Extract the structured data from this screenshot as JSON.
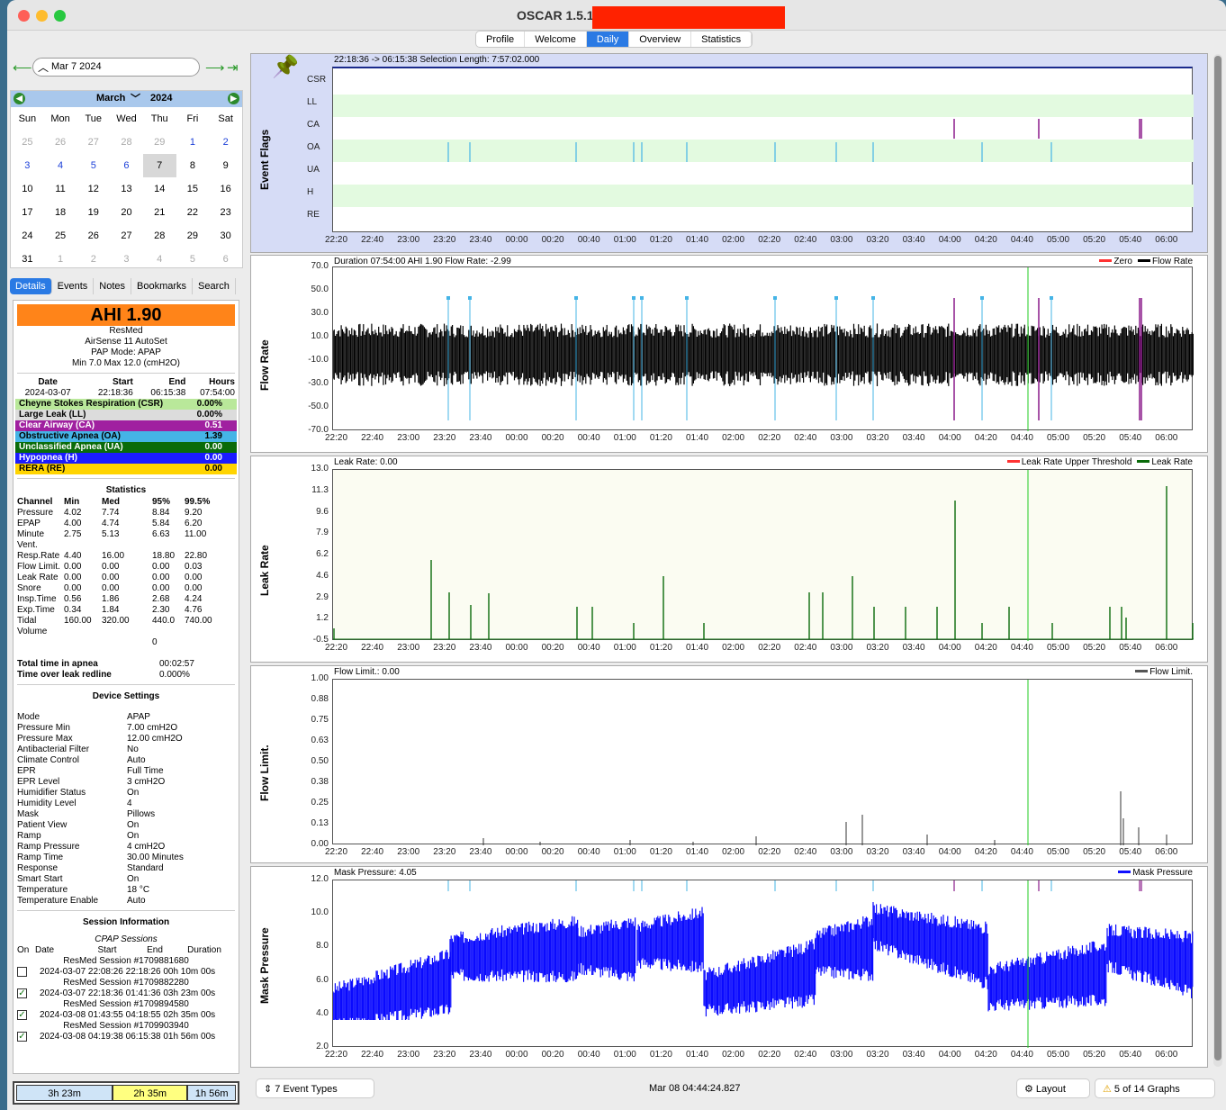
{
  "app": {
    "title": "OSCAR 1.5.1"
  },
  "tabs": [
    "Profile",
    "Welcome",
    "Daily",
    "Overview",
    "Statistics"
  ],
  "nav": {
    "date": "Mar 7 2024"
  },
  "calendar": {
    "month": "March",
    "year": "2024",
    "days": [
      "Sun",
      "Mon",
      "Tue",
      "Wed",
      "Thu",
      "Fri",
      "Sat"
    ],
    "cells": [
      "25",
      "26",
      "27",
      "28",
      "29",
      "1",
      "2",
      "3",
      "4",
      "5",
      "6",
      "7",
      "8",
      "9",
      "10",
      "11",
      "12",
      "13",
      "14",
      "15",
      "16",
      "17",
      "18",
      "19",
      "20",
      "21",
      "22",
      "23",
      "24",
      "25",
      "26",
      "27",
      "28",
      "29",
      "30",
      "31",
      "1",
      "2",
      "3",
      "4",
      "5",
      "6"
    ]
  },
  "left_tabs": [
    "Details",
    "Events",
    "Notes",
    "Bookmarks",
    "Search"
  ],
  "details": {
    "ahi": "AHI 1.90",
    "brand": "ResMed",
    "model": "AirSense 11 AutoSet",
    "mode": "PAP Mode: APAP",
    "range": "Min 7.0 Max 12.0 (cmH2O)",
    "hdr": [
      "Date",
      "Start",
      "End",
      "Hours"
    ],
    "vals": [
      "2024-03-07",
      "22:18:36",
      "06:15:38",
      "07:54:00"
    ],
    "events": [
      [
        "Cheyne Stokes Respiration (CSR)",
        "0.00%",
        "#b9e89a",
        "#000"
      ],
      [
        "Large Leak (LL)",
        "0.00%",
        "#dcdcdc",
        "#000"
      ],
      [
        "Clear Airway (CA)",
        "0.51",
        "#a020a0",
        "#fff"
      ],
      [
        "Obstructive Apnea (OA)",
        "1.39",
        "#45b4e6",
        "#000"
      ],
      [
        "Unclassified Apnea (UA)",
        "0.00",
        "#0a6b0a",
        "#fff"
      ],
      [
        "Hypopnea (H)",
        "0.00",
        "#1b1bff",
        "#fff"
      ],
      [
        "RERA (RE)",
        "0.00",
        "#ffd400",
        "#000"
      ]
    ],
    "stats_title": "Statistics",
    "stats_hdr": [
      "Channel",
      "Min",
      "Med",
      "95%",
      "99.5%"
    ],
    "stats": [
      [
        "Pressure",
        "4.02",
        "7.74",
        "8.84",
        "9.20"
      ],
      [
        "EPAP",
        "4.00",
        "4.74",
        "5.84",
        "6.20"
      ],
      [
        "Minute Vent.",
        "2.75",
        "5.13",
        "6.63",
        "11.00"
      ],
      [
        "Resp.Rate",
        "4.40",
        "16.00",
        "18.80",
        "22.80"
      ],
      [
        "Flow Limit.",
        "0.00",
        "0.00",
        "0.00",
        "0.03"
      ],
      [
        "Leak Rate",
        "0.00",
        "0.00",
        "0.00",
        "0.00"
      ],
      [
        "Snore",
        "0.00",
        "0.00",
        "0.00",
        "0.00"
      ],
      [
        "Insp.Time",
        "0.56",
        "1.86",
        "2.68",
        "4.24"
      ],
      [
        "Exp.Time",
        "0.34",
        "1.84",
        "2.30",
        "4.76"
      ],
      [
        "Tidal Volume",
        "160.00",
        "320.00",
        "440.0",
        "740.00"
      ],
      [
        "",
        "",
        "",
        "0",
        ""
      ]
    ],
    "apnea": [
      [
        "Total time in apnea",
        "00:02:57"
      ],
      [
        "Time over leak redline",
        "0.000%"
      ]
    ],
    "device_title": "Device Settings",
    "device": [
      [
        "Mode",
        "APAP"
      ],
      [
        "Pressure Min",
        "7.00 cmH2O"
      ],
      [
        "Pressure Max",
        "12.00 cmH2O"
      ],
      [
        "Antibacterial Filter",
        "No"
      ],
      [
        "Climate Control",
        "Auto"
      ],
      [
        "EPR",
        "Full Time"
      ],
      [
        "EPR Level",
        "3 cmH2O"
      ],
      [
        "Humidifier Status",
        "On"
      ],
      [
        "Humidity Level",
        "4"
      ],
      [
        "Mask",
        "Pillows"
      ],
      [
        "Patient View",
        "On"
      ],
      [
        "Ramp",
        "On"
      ],
      [
        "Ramp Pressure",
        "4 cmH2O"
      ],
      [
        "Ramp Time",
        "30.00 Minutes"
      ],
      [
        "Response",
        "Standard"
      ],
      [
        "Smart Start",
        "On"
      ],
      [
        "Temperature",
        "18 °C"
      ],
      [
        "Temperature Enable",
        "Auto"
      ]
    ],
    "session_title": "Session Information",
    "cpap": "CPAP Sessions",
    "sess_hdr": [
      "On",
      "Date",
      "Start",
      "End",
      "Duration"
    ],
    "sessions": [
      [
        "ResMed Session #1709881680",
        "2024-03-07 22:08:26 22:18:26 00h 10m 00s",
        false
      ],
      [
        "ResMed Session #1709882280",
        "2024-03-07 22:18:36 01:41:36 03h 23m 00s",
        true
      ],
      [
        "ResMed Session #1709894580",
        "2024-03-08 01:43:55 04:18:55 02h 35m 00s",
        true
      ],
      [
        "ResMed Session #1709903940",
        "2024-03-08 04:19:38 06:15:38 01h 56m 00s",
        true
      ]
    ],
    "bottom": [
      "3h 23m",
      "2h 35m",
      "1h 56m"
    ]
  },
  "graphs": {
    "xticks": [
      "22:20",
      "22:40",
      "23:00",
      "23:20",
      "23:40",
      "00:00",
      "00:20",
      "00:40",
      "01:00",
      "01:20",
      "01:40",
      "02:00",
      "02:20",
      "02:40",
      "03:00",
      "03:20",
      "03:40",
      "04:00",
      "04:20",
      "04:40",
      "05:00",
      "05:20",
      "05:40",
      "06:00"
    ],
    "flags": {
      "label": "Event Flags",
      "header": "22:18:36 -> 06:15:38      Selection Length: 7:57:02.000",
      "rows": [
        "CSR",
        "LL",
        "CA",
        "OA",
        "UA",
        "H",
        "RE"
      ]
    },
    "flow": {
      "label": "Flow Rate",
      "header": "Duration 07:54:00 AHI 1.90 Flow Rate: -2.99",
      "legend": [
        "Zero",
        "Flow Rate"
      ],
      "yticks": [
        "70.0",
        "50.0",
        "30.0",
        "10.0",
        "-10.0",
        "-30.0",
        "-50.0",
        "-70.0"
      ]
    },
    "leak": {
      "label": "Leak Rate",
      "header": "Leak Rate: 0.00",
      "legend": [
        "Leak Rate Upper Threshold",
        "Leak Rate"
      ],
      "yticks": [
        "13.0",
        "11.3",
        "9.6",
        "7.9",
        "6.2",
        "4.6",
        "2.9",
        "1.2",
        "-0.5"
      ]
    },
    "flim": {
      "label": "Flow Limit.",
      "header": "Flow Limit.: 0.00",
      "legend": [
        "Flow Limit."
      ],
      "yticks": [
        "1.00",
        "0.88",
        "0.75",
        "0.63",
        "0.50",
        "0.38",
        "0.25",
        "0.13",
        "0.00"
      ]
    },
    "mask": {
      "label": "Mask Pressure",
      "header": "Mask Pressure: 4.05",
      "legend": [
        "Mask Pressure"
      ],
      "yticks": [
        "12.0",
        "10.0",
        "8.0",
        "6.0",
        "4.0",
        "2.0"
      ]
    }
  },
  "bottombar": {
    "events": "7 Event Types",
    "time": "Mar 08 04:44:24.827",
    "layout": "Layout",
    "graphs": "5 of 14 Graphs"
  }
}
